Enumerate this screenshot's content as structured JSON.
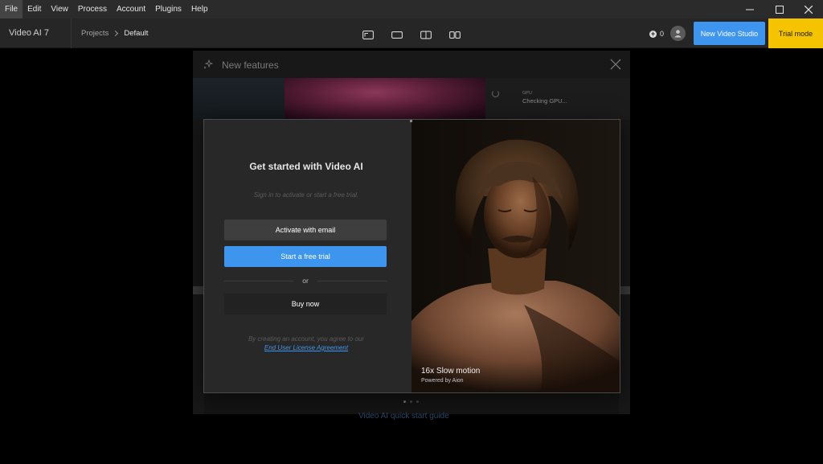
{
  "menu": {
    "items": [
      "File",
      "Edit",
      "View",
      "Process",
      "Account",
      "Plugins",
      "Help"
    ],
    "active": "File"
  },
  "window_controls": [
    "minimize-icon",
    "maximize-icon",
    "close-icon"
  ],
  "topbar": {
    "app_title": "Video AI  7",
    "breadcrumb": {
      "projects": "Projects",
      "current": "Default"
    },
    "view_modes": [
      "single-view-icon",
      "original-view-icon",
      "side-by-side-icon",
      "split-view-icon"
    ],
    "credits_count": "0",
    "new_studio_label": "New Video Studio",
    "trial_label": "Trial mode"
  },
  "background_modal": {
    "title": "New features",
    "gpu_label": "GPU",
    "gpu_status": "Checking GPU...",
    "quickstart_link": "Video AI quick start guide"
  },
  "dialog": {
    "title": "Get started with Video AI",
    "subtitle": "Sign in to activate or start a free trial.",
    "activate_label": "Activate with email",
    "trial_label": "Start a free trial",
    "or_text": "or",
    "buy_label": "Buy now",
    "legal_text": "By creating an account, you agree to our",
    "eula_link": "End User License Agreement",
    "image_caption": "16x Slow motion",
    "image_powered": "Powered by Aion"
  },
  "colors": {
    "accent_blue": "#3e95ee",
    "trial_yellow": "#f5c300",
    "menubar_bg": "#2b2b2b",
    "dialog_bg": "#282828"
  }
}
